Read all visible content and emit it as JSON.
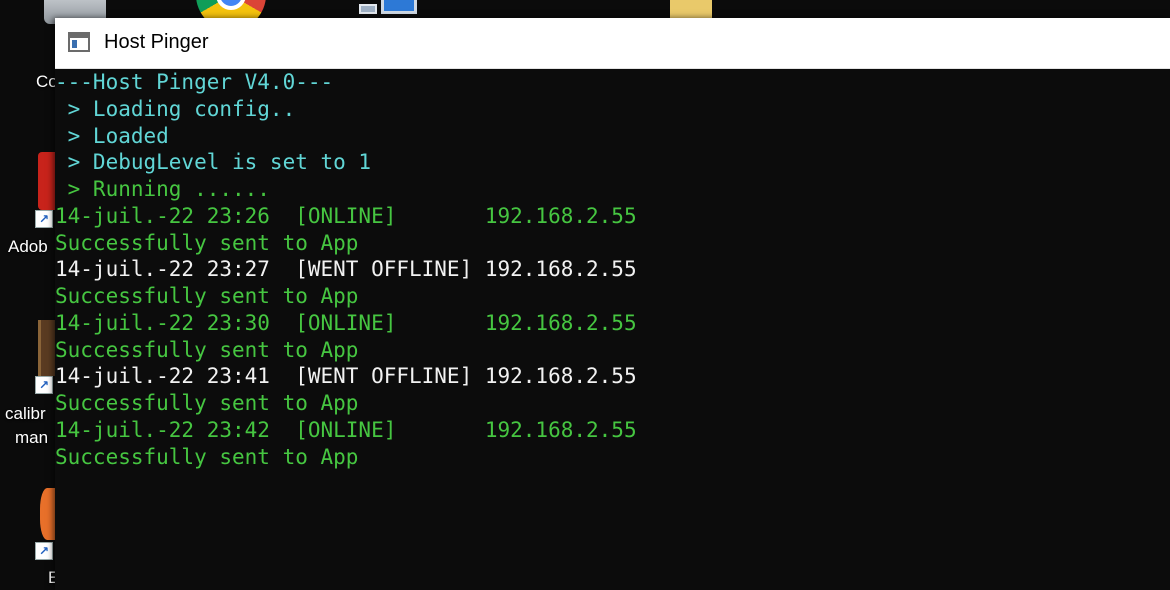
{
  "desktop": {
    "icons": [
      {
        "name": "recycle-bin",
        "label": "Co"
      },
      {
        "name": "adobe",
        "label": "Adob"
      },
      {
        "name": "calibre",
        "label": "calibr",
        "label2": "man"
      },
      {
        "name": "other",
        "label": "E"
      }
    ]
  },
  "window": {
    "title": "Host Pinger"
  },
  "console": {
    "lines": [
      {
        "text": "---Host Pinger V4.0---",
        "color": "#61d6d6"
      },
      {
        "text": " > Loading config..",
        "color": "#61d6d6"
      },
      {
        "text": " > Loaded",
        "color": "#61d6d6"
      },
      {
        "text": " > DebugLevel is set to 1",
        "color": "#61d6d6"
      },
      {
        "text": " > Running ......",
        "color": "#46c641"
      },
      {
        "text": "14-juil.-22 23:26  [ONLINE]       192.168.2.55",
        "color": "#46c641"
      },
      {
        "text": "Successfully sent to App",
        "color": "#46c641"
      },
      {
        "text": "14-juil.-22 23:27  [WENT OFFLINE] 192.168.2.55",
        "color": "#f2f2f2"
      },
      {
        "text": "Successfully sent to App",
        "color": "#46c641"
      },
      {
        "text": "14-juil.-22 23:30  [ONLINE]       192.168.2.55",
        "color": "#46c641"
      },
      {
        "text": "Successfully sent to App",
        "color": "#46c641"
      },
      {
        "text": "14-juil.-22 23:41  [WENT OFFLINE] 192.168.2.55",
        "color": "#f2f2f2"
      },
      {
        "text": "Successfully sent to App",
        "color": "#46c641"
      },
      {
        "text": "14-juil.-22 23:42  [ONLINE]       192.168.2.55",
        "color": "#46c641"
      },
      {
        "text": "Successfully sent to App",
        "color": "#46c641"
      }
    ]
  }
}
